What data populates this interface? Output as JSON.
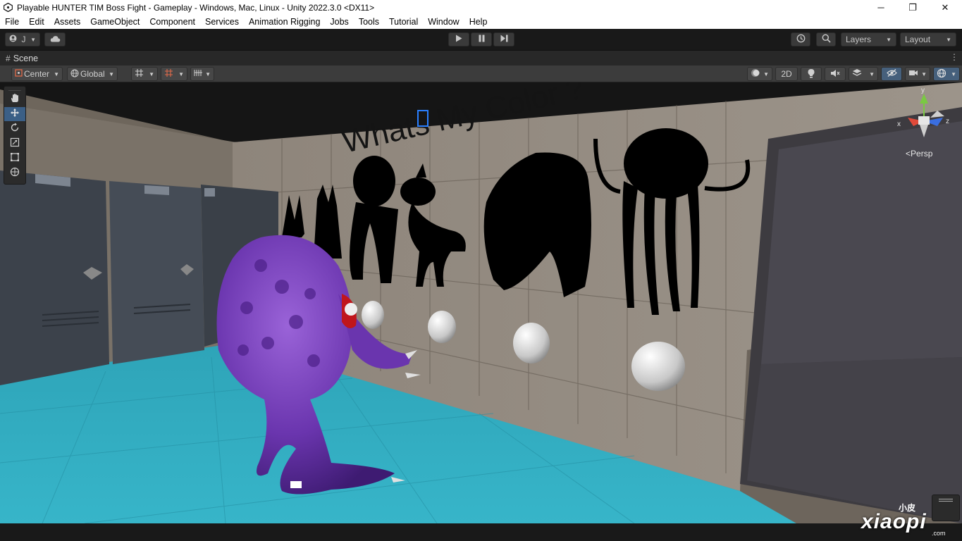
{
  "window": {
    "title": "Playable HUNTER TIM Boss Fight - Gameplay - Windows, Mac, Linux - Unity 2022.3.0 <DX11>",
    "minimize": "─",
    "restore": "❐",
    "close": "✕"
  },
  "menu": [
    "File",
    "Edit",
    "Assets",
    "GameObject",
    "Component",
    "Services",
    "Animation Rigging",
    "Jobs",
    "Tools",
    "Tutorial",
    "Window",
    "Help"
  ],
  "toolbar": {
    "account_label": "J",
    "layers_label": "Layers",
    "layout_label": "Layout"
  },
  "scene_tab": {
    "label": "Scene"
  },
  "scene_toolbar": {
    "pivot_label": "Center",
    "space_label": "Global",
    "mode_2d": "2D"
  },
  "viewport": {
    "wall_text": "Whats My Color ?",
    "projection_label": "Persp",
    "gizmo": {
      "x": "x",
      "y": "y",
      "z": "z"
    }
  },
  "watermark": {
    "top": "小皮",
    "main": "xiaopi",
    "sub": ".com"
  },
  "icons": [
    "unity-logo-icon",
    "account-icon",
    "cloud-icon",
    "play-icon",
    "pause-icon",
    "step-icon",
    "history-icon",
    "search-icon",
    "hand-tool-icon",
    "move-tool-icon",
    "rotate-tool-icon",
    "scale-tool-icon",
    "rect-tool-icon",
    "transform-tool-icon"
  ]
}
